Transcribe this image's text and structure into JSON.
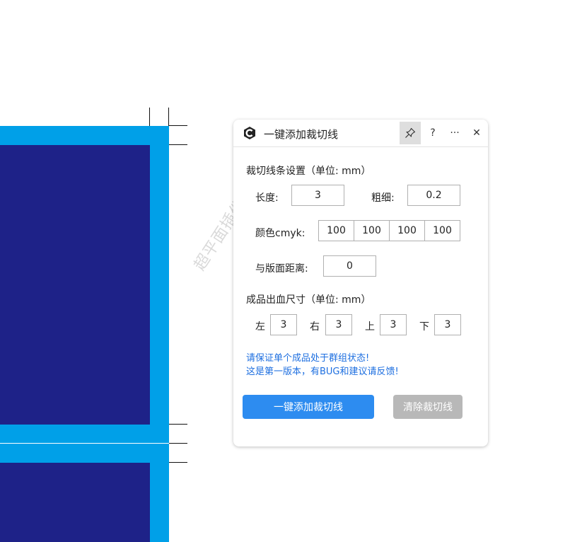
{
  "watermark": "超平面插件 cdrvcp.cn",
  "panel": {
    "title": "一键添加裁切线",
    "help_label": "?",
    "more_label": "···",
    "close_label": "✕",
    "crop_section_title": "裁切线条设置（单位: mm）",
    "length_label": "长度:",
    "length_value": "3",
    "thickness_label": "粗细:",
    "thickness_value": "0.2",
    "color_label": "颜色cmyk:",
    "cmyk": [
      "100",
      "100",
      "100",
      "100"
    ],
    "distance_label": "与版面距离:",
    "distance_value": "0",
    "bleed_section_title": "成品出血尺寸（单位: mm）",
    "bleed": {
      "left_label": "左",
      "left_value": "3",
      "right_label": "右",
      "right_value": "3",
      "top_label": "上",
      "top_value": "3",
      "bottom_label": "下",
      "bottom_value": "3"
    },
    "note_line1": "请保证单个成品处于群组状态!",
    "note_line2": "这是第一版本，有BUG和建议请反馈!",
    "add_button": "一键添加裁切线",
    "clear_button": "清除裁切线"
  },
  "colors": {
    "accent": "#2d8cf0",
    "frame_cyan": "#00a0e8",
    "inner_navy": "#1e2288",
    "note_blue": "#1e6fe0",
    "disabled": "#b8b8b8"
  }
}
